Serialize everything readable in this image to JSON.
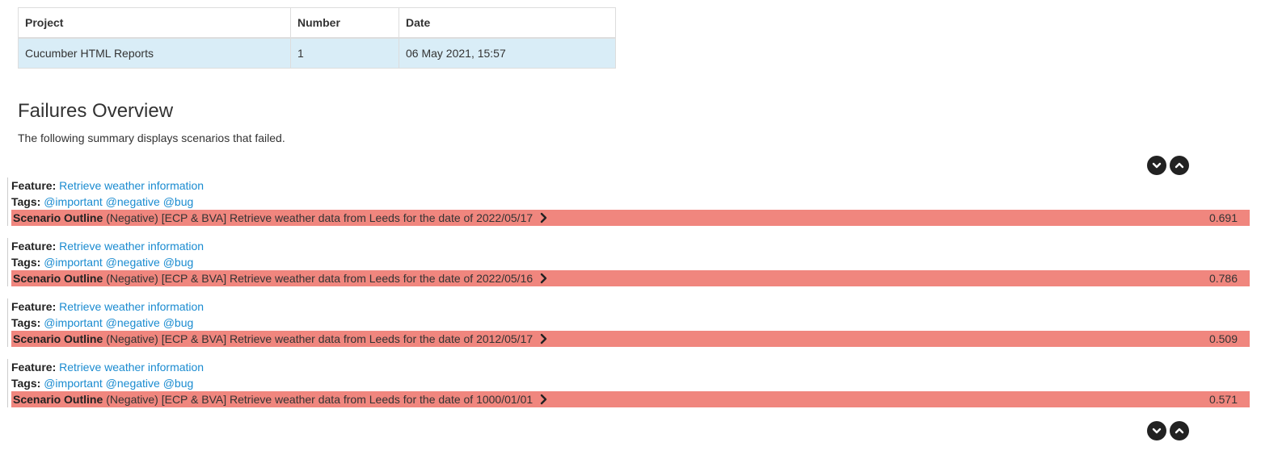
{
  "summary_table": {
    "headers": [
      "Project",
      "Number",
      "Date"
    ],
    "row": {
      "project": "Cucumber HTML Reports",
      "number": "1",
      "date": "06 May 2021, 15:57"
    }
  },
  "failures_overview": {
    "title": "Failures Overview",
    "description": "The following summary displays scenarios that failed."
  },
  "labels": {
    "feature": "Feature:",
    "tags": "Tags:",
    "scenario_outline": "Scenario Outline"
  },
  "icons": {
    "expand": "chevron-down-icon",
    "collapse": "chevron-up-icon",
    "scenario_arrow": "chevron-right-icon"
  },
  "colors": {
    "failed_bar": "#f0867e",
    "link": "#1a8bd0",
    "table_row": "#d9edf7"
  },
  "failures": [
    {
      "feature": "Retrieve weather information",
      "tags": [
        "@important",
        "@negative",
        "@bug"
      ],
      "scenario": "(Negative) [ECP & BVA] Retrieve weather data from Leeds for the date of 2022/05/17",
      "duration": "0.691"
    },
    {
      "feature": "Retrieve weather information",
      "tags": [
        "@important",
        "@negative",
        "@bug"
      ],
      "scenario": "(Negative) [ECP & BVA] Retrieve weather data from Leeds for the date of 2022/05/16",
      "duration": "0.786"
    },
    {
      "feature": "Retrieve weather information",
      "tags": [
        "@important",
        "@negative",
        "@bug"
      ],
      "scenario": "(Negative) [ECP & BVA] Retrieve weather data from Leeds for the date of 2012/05/17",
      "duration": "0.509"
    },
    {
      "feature": "Retrieve weather information",
      "tags": [
        "@important",
        "@negative",
        "@bug"
      ],
      "scenario": "(Negative) [ECP & BVA] Retrieve weather data from Leeds for the date of 1000/01/01",
      "duration": "0.571"
    }
  ]
}
